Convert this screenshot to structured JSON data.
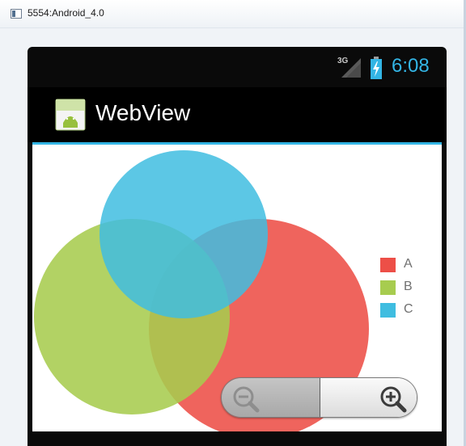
{
  "window": {
    "title": "5554:Android_4.0"
  },
  "status_bar": {
    "network": "3G",
    "time": "6:08"
  },
  "action_bar": {
    "title": "WebView"
  },
  "venn": {
    "sets": [
      {
        "label": "A",
        "color": "#ed4f47"
      },
      {
        "label": "B",
        "color": "#a7cc4f"
      },
      {
        "label": "C",
        "color": "#3fbde0"
      }
    ]
  },
  "colors": {
    "accent": "#33b5e5",
    "device_bg": "#000000"
  },
  "icons": {
    "status": [
      "signal-icon",
      "battery-charging-icon"
    ],
    "zoom": [
      "zoom-out-icon",
      "zoom-in-icon"
    ]
  }
}
